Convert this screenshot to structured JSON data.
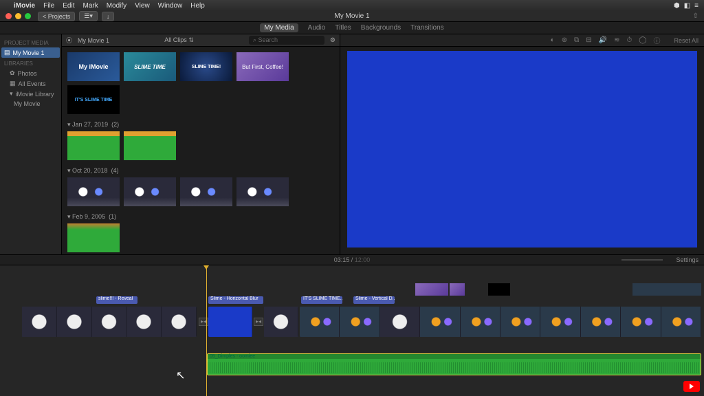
{
  "menubar": {
    "app": "iMovie",
    "items": [
      "File",
      "Edit",
      "Mark",
      "Modify",
      "View",
      "Window",
      "Help"
    ]
  },
  "titlebar": {
    "back": "Projects",
    "title": "My Movie 1"
  },
  "tabs": {
    "media": "My Media",
    "audio": "Audio",
    "titles": "Titles",
    "backgrounds": "Backgrounds",
    "transitions": "Transitions"
  },
  "sidebar": {
    "section1": "PROJECT MEDIA",
    "proj": "My Movie 1",
    "section2": "LIBRARIES",
    "items": [
      "Photos",
      "All Events",
      "iMovie Library",
      "My Movie"
    ]
  },
  "browser": {
    "title": "My Movie 1",
    "filter": "All Clips",
    "search_ph": "Search",
    "thumbs_top": [
      "My iMovie",
      "SLIME TIME",
      "SLIME TIME!",
      "But First, Coffee!",
      "IT'S SLIME TIME"
    ],
    "events": [
      {
        "label": "Jan 27, 2019",
        "count": "(2)"
      },
      {
        "label": "Oct 20, 2018",
        "count": "(4)"
      },
      {
        "label": "Feb 9, 2005",
        "count": "(1)"
      }
    ]
  },
  "viewer": {
    "reset": "Reset All"
  },
  "timeline": {
    "time": "03:15",
    "duration": "12:00",
    "settings": "Settings",
    "titles": [
      "slime!!! - Reveal",
      "Slime - Horizontal Blur",
      "IT'S SLIME TIME...",
      "Slime - Vertical D..."
    ],
    "audio_label": "05_Dimples - oomiee"
  }
}
